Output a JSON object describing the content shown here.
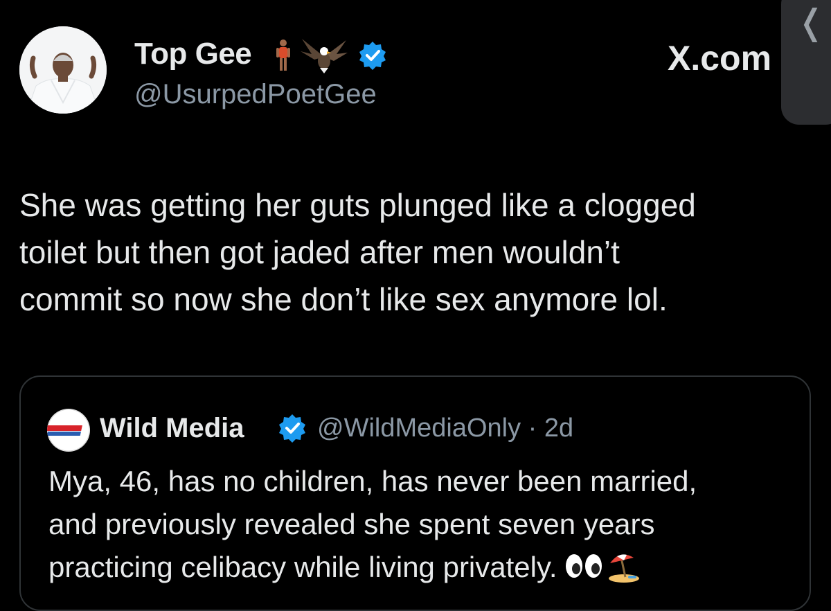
{
  "author": {
    "display_name": "Top Gee",
    "handle": "@UsurpedPoetGee",
    "name_emojis": [
      "man-standing-icon",
      "eagle-icon",
      "verified-badge-icon"
    ],
    "avatar": "avatar"
  },
  "brand": {
    "logo_text": "X.com"
  },
  "tweet": {
    "text": "She was getting her guts plunged like a clogged\ntoilet but then got jaded after men wouldn’t\ncommit so now she don’t like sex anymore lol."
  },
  "quoted": {
    "display_name": "Wild Media",
    "handle_time": "@WildMediaOnly · 2d",
    "text": "Mya, 46, has no children, has never been married,\nand previously revealed she spent seven years\npracticing celibacy while living privately.",
    "emojis": [
      "eyes-icon",
      "beach-umbrella-icon"
    ]
  },
  "colors": {
    "background": "#000000",
    "primary_text": "#e7e9ea",
    "secondary_text": "#8b98a5",
    "verified": "#1d9bf0",
    "border": "#2f3336"
  }
}
